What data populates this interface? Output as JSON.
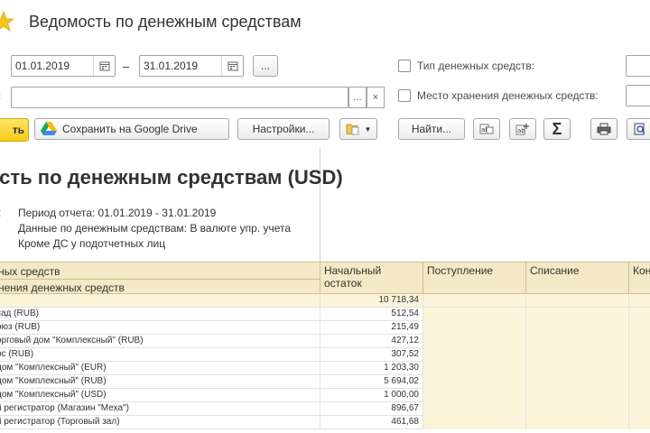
{
  "header": {
    "title": "Ведомость по денежным средствам"
  },
  "period": {
    "from": "01.01.2019",
    "dash": "–",
    "to": "31.01.2019",
    "more_label": "..."
  },
  "filters": {
    "cash_type_label": "Тип денежных средств:",
    "storage_label": "Место хранения денежных средств:"
  },
  "org_row": {
    "prefix": ":",
    "value": "",
    "select_label": "...",
    "clear_label": "×"
  },
  "toolbar": {
    "form_label": "ть",
    "save_gdrive_label": "Сохранить на Google Drive",
    "settings_label": "Настройки...",
    "find_label": "Найти...",
    "sum_label": "Σ"
  },
  "report": {
    "title": "мость по денежным средствам (USD)",
    "params_prefix": ":",
    "period_text": "Период отчета: 01.01.2019 - 31.01.2019",
    "cash_text": "Данные по денежным средствам: В валюте упр. учета",
    "except_text": "Кроме ДС у подотчетных лиц"
  },
  "table": {
    "head_left_1": "ных средств",
    "head_left_2": "нения денежных средств",
    "columns": [
      "Начальный остаток",
      "Поступление",
      "Списание",
      "Конечный остаток"
    ],
    "total_value": "10 718,34",
    "rows": [
      {
        "name": "сад (RUB)",
        "value": "512,54"
      },
      {
        "name": "оюз (RUB)",
        "value": "215,49"
      },
      {
        "name": "орговый дом \"Комплексный\" (RUB)",
        "value": "427,12"
      },
      {
        "name": "ос (RUB)",
        "value": "307,52"
      },
      {
        "name": "дом \"Комплексный\" (EUR)",
        "value": "1 203,30"
      },
      {
        "name": "дом \"Комплексный\" (RUB)",
        "value": "5 694,02"
      },
      {
        "name": "дом \"Комплексный\" (USD)",
        "value": "1 000,00"
      },
      {
        "name": "й регистратор (Магазин \"Меха\")",
        "value": "896,67"
      },
      {
        "name": "й регистратор (Торговый зал)",
        "value": "461,68"
      }
    ]
  }
}
